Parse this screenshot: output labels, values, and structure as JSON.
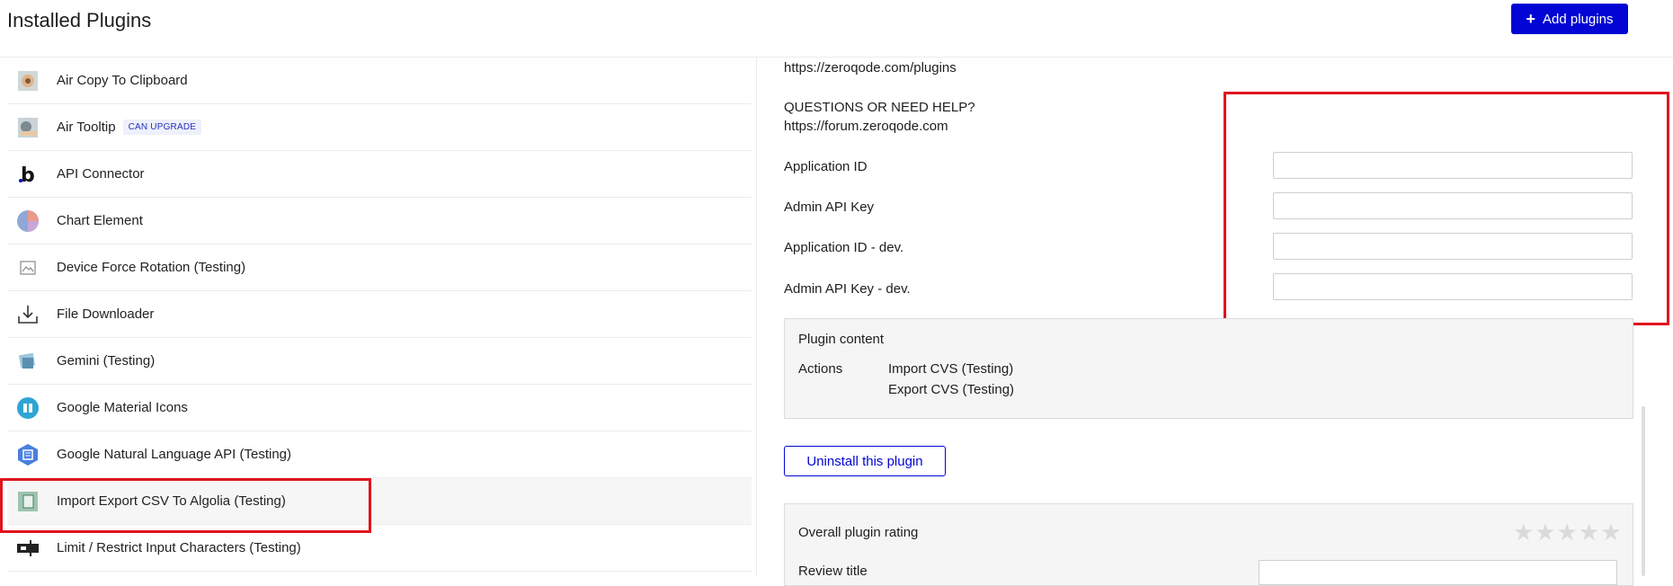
{
  "header": {
    "title": "Installed Plugins",
    "add_button_icon": "plus-icon",
    "add_button_label": "Add plugins",
    "accent_color": "#0205d3"
  },
  "plugins": [
    {
      "name": "Air Copy To Clipboard",
      "icon": "clipboard-icon"
    },
    {
      "name": "Air Tooltip",
      "icon": "tooltip-icon",
      "badge": "CAN UPGRADE"
    },
    {
      "name": "API Connector",
      "icon": "bubble-b-icon"
    },
    {
      "name": "Chart Element",
      "icon": "pie-chart-icon"
    },
    {
      "name": "Device Force Rotation (Testing)",
      "icon": "image-placeholder-icon"
    },
    {
      "name": "File Downloader",
      "icon": "download-icon"
    },
    {
      "name": "Gemini (Testing)",
      "icon": "gemini-icon"
    },
    {
      "name": "Google Material Icons",
      "icon": "material-icons-icon"
    },
    {
      "name": "Google Natural Language API (Testing)",
      "icon": "natural-language-icon"
    },
    {
      "name": "Import Export CSV To Algolia (Testing)",
      "icon": "csv-file-icon",
      "selected": true
    },
    {
      "name": "Limit / Restrict Input Characters (Testing)",
      "icon": "text-cursor-icon"
    }
  ],
  "detail": {
    "website_link": "https://zeroqode.com/plugins",
    "help_heading": "QUESTIONS OR NEED HELP?",
    "help_link": "https://forum.zeroqode.com",
    "fields": [
      {
        "label": "Application ID",
        "value": ""
      },
      {
        "label": "Admin API Key",
        "value": ""
      },
      {
        "label": "Application ID - dev.",
        "value": ""
      },
      {
        "label": "Admin API Key - dev.",
        "value": ""
      }
    ],
    "plugin_content": {
      "title": "Plugin content",
      "actions_label": "Actions",
      "actions": [
        "Import CVS (Testing)",
        "Export CVS (Testing)"
      ]
    },
    "uninstall_label": "Uninstall this plugin",
    "rating": {
      "title": "Overall plugin rating",
      "stars": "★★★★★",
      "review_title_label": "Review title"
    }
  },
  "highlight_color": "#e0141e"
}
